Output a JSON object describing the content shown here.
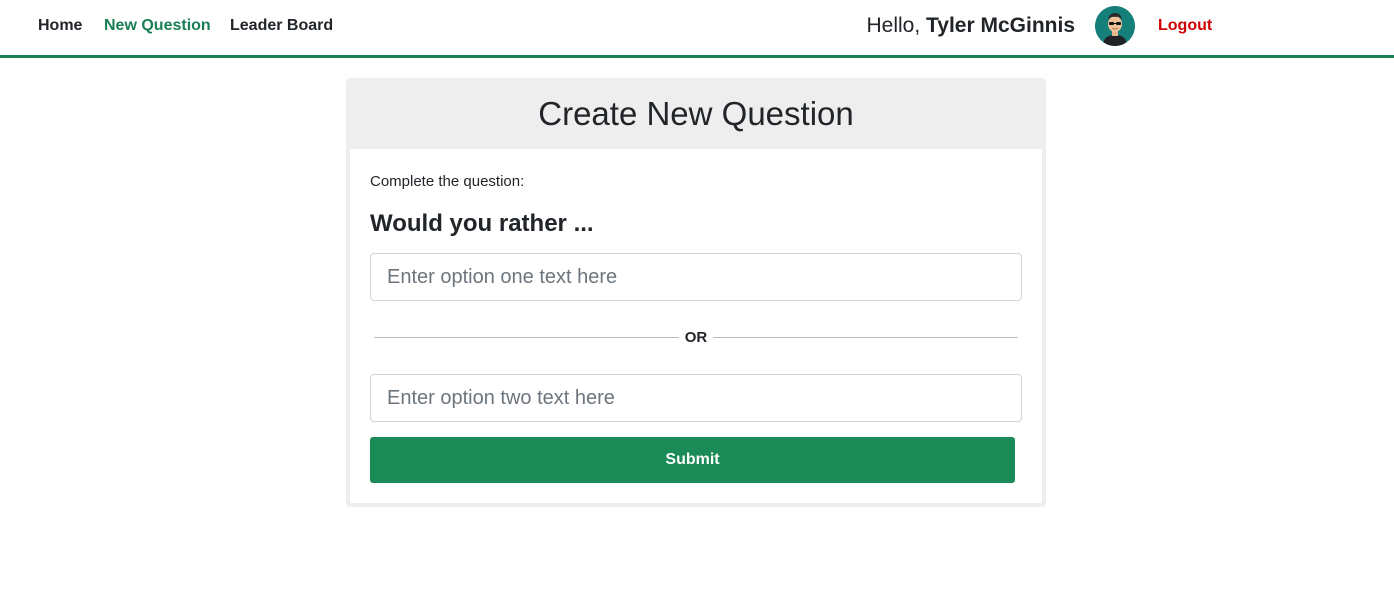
{
  "nav": {
    "home": "Home",
    "new_question": "New Question",
    "leader_board": "Leader Board",
    "active": "New Question"
  },
  "user": {
    "greeting": "Hello,",
    "name": "Tyler McGinnis",
    "avatar_icon": "user-avatar-icon",
    "logout": "Logout"
  },
  "colors": {
    "accent": "#1a7f55",
    "submit_bg": "#1a8a56",
    "logout": "#d00000",
    "avatar_bg": "#15807a"
  },
  "form": {
    "title": "Create New Question",
    "prompt": "Complete the question:",
    "would_you_rather": "Would you rather ...",
    "option_one": {
      "value": "",
      "placeholder": "Enter option one text here"
    },
    "separator": "OR",
    "option_two": {
      "value": "",
      "placeholder": "Enter option two text here"
    },
    "submit_label": "Submit"
  }
}
